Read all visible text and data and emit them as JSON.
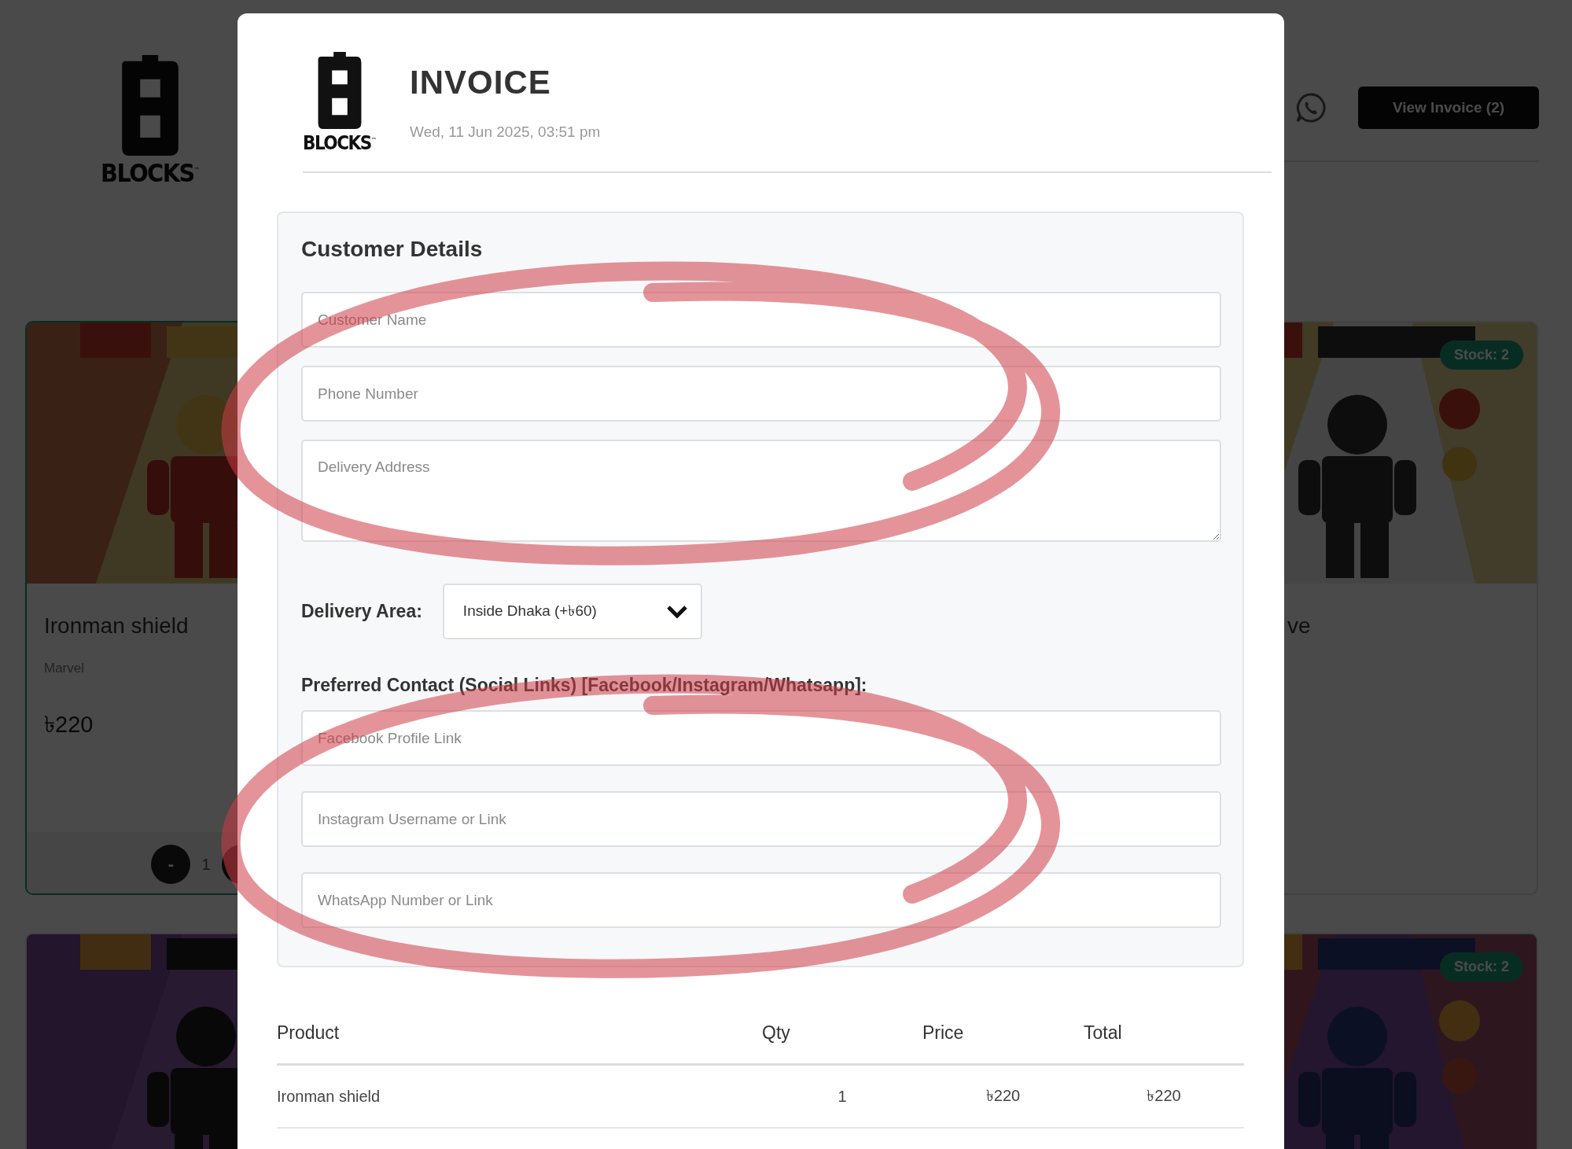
{
  "background_page": {
    "logo_text": "BLOCKS$^{™}$",
    "view_invoice_button": "View Invoice (2)",
    "products": [
      {
        "selected": true,
        "name": "Ironman shield",
        "brand": "Marvel",
        "price": "৳220",
        "quantity": "1",
        "minus": "-"
      },
      {
        "selected": false,
        "stock": "Stock: 2",
        "name": "ve"
      },
      {
        "selected": false
      },
      {
        "selected": false,
        "stock": "Stock: 2"
      }
    ]
  },
  "invoice": {
    "logo_text": "BLOCKS$^{™}$",
    "title": "INVOICE",
    "date": "Wed, 11 Jun 2025, 03:51 pm",
    "customer_details": {
      "heading": "Customer Details",
      "fields": [
        {
          "kind": "input",
          "placeholder": "Customer Name"
        },
        {
          "kind": "input",
          "placeholder": "Phone Number"
        },
        {
          "kind": "textarea",
          "placeholder": "Delivery Address"
        }
      ],
      "delivery_area": {
        "label": "Delivery Area:",
        "value": "Inside Dhaka (+৳60)"
      },
      "contact_heading": "Preferred Contact (Social Links) [Facebook/Instagram/Whatsapp]:",
      "contact_fields": [
        {
          "placeholder": "Facebook Profile Link"
        },
        {
          "placeholder": "Instagram Username or Link"
        },
        {
          "placeholder": "WhatsApp Number or Link"
        }
      ]
    },
    "table": {
      "columns": [
        "Product",
        "Qty",
        "Price",
        "Total"
      ],
      "rows": [
        [
          "Ironman shield",
          "1",
          "৳220",
          "৳220"
        ]
      ]
    }
  }
}
